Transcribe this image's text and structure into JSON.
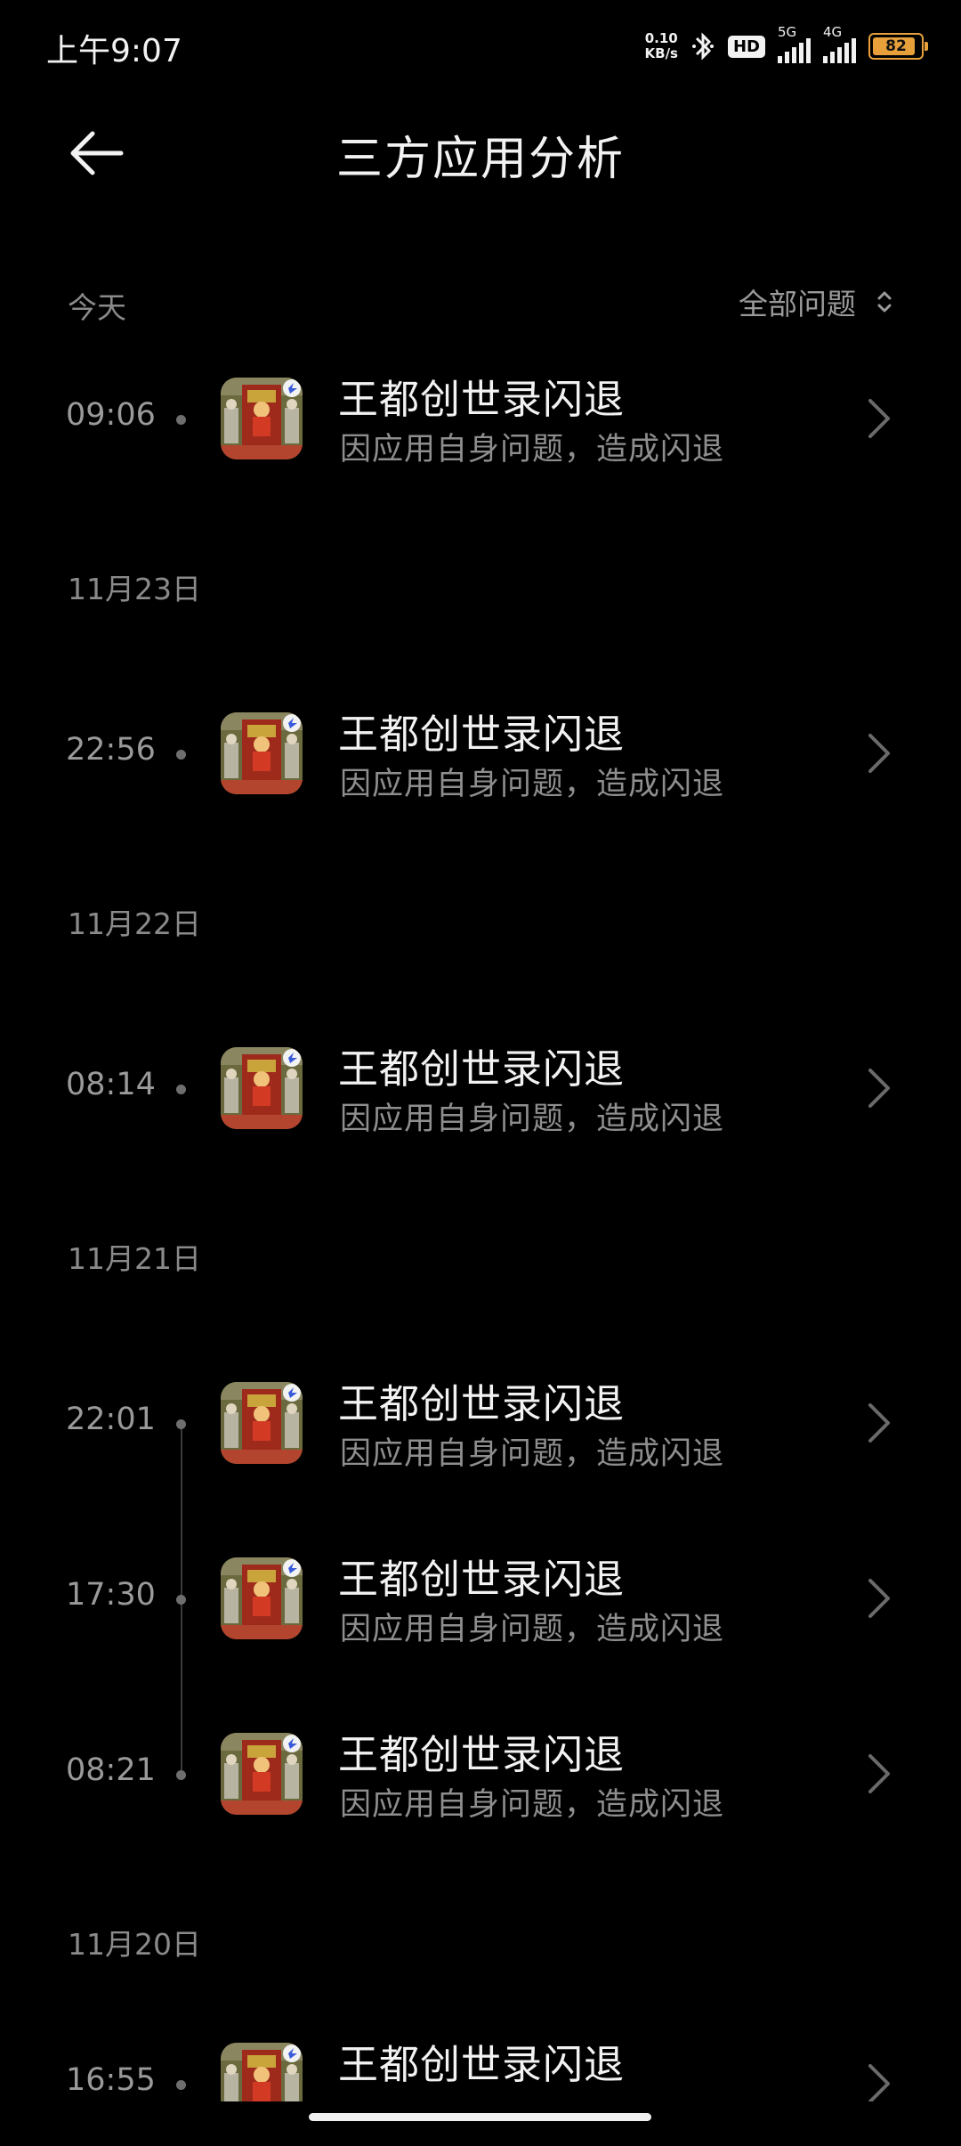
{
  "status_bar": {
    "time": "上午9:07",
    "net_speed_value": "0.10",
    "net_speed_unit": "KB/s",
    "hd_label": "HD",
    "sim1_label": "5G",
    "sim2_label": "4G",
    "battery_level": "82",
    "icons": [
      "bluetooth-icon",
      "signal-icon",
      "battery-icon"
    ],
    "battery_color": "#e8a13a"
  },
  "header": {
    "title": "三方应用分析",
    "back_icon": "arrow-left-icon"
  },
  "filter": {
    "today_label": "今天",
    "filter_label": "全部问题",
    "filter_icon": "sort-updown-icon"
  },
  "groups": [
    {
      "date": "",
      "items": [
        {
          "time": "09:06",
          "app_name": "王都创世录闪退",
          "reason": "因应用自身问题，造成闪退"
        }
      ]
    },
    {
      "date": "11月23日",
      "items": [
        {
          "time": "22:56",
          "app_name": "王都创世录闪退",
          "reason": "因应用自身问题，造成闪退"
        }
      ]
    },
    {
      "date": "11月22日",
      "items": [
        {
          "time": "08:14",
          "app_name": "王都创世录闪退",
          "reason": "因应用自身问题，造成闪退"
        }
      ]
    },
    {
      "date": "11月21日",
      "items": [
        {
          "time": "22:01",
          "app_name": "王都创世录闪退",
          "reason": "因应用自身问题，造成闪退"
        },
        {
          "time": "17:30",
          "app_name": "王都创世录闪退",
          "reason": "因应用自身问题，造成闪退"
        },
        {
          "time": "08:21",
          "app_name": "王都创世录闪退",
          "reason": "因应用自身问题，造成闪退"
        }
      ]
    },
    {
      "date": "11月20日",
      "items": [
        {
          "time": "16:55",
          "app_name": "王都创世录闪退",
          "reason": ""
        }
      ]
    }
  ],
  "colors": {
    "background": "#000000",
    "primary_text": "#f2f2f2",
    "secondary_text": "#8e8e8e"
  }
}
